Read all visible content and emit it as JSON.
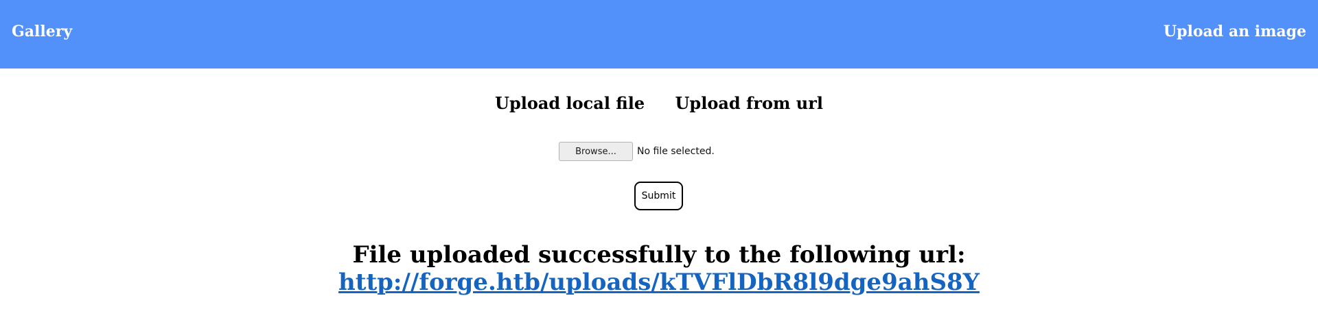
{
  "header": {
    "brand": "Gallery",
    "upload_link": "Upload an image",
    "background_color": "#5291fa"
  },
  "tabs": [
    {
      "label": "Upload local file"
    },
    {
      "label": "Upload from url"
    }
  ],
  "file_input": {
    "browse_label": "Browse...",
    "status": "No file selected."
  },
  "submit": {
    "label": "Submit"
  },
  "result": {
    "message": "File uploaded successfully to the following url:",
    "url": "http://forge.htb/uploads/kTVFlDbR8l9dge9ahS8Y",
    "link_color": "#1565c0"
  }
}
